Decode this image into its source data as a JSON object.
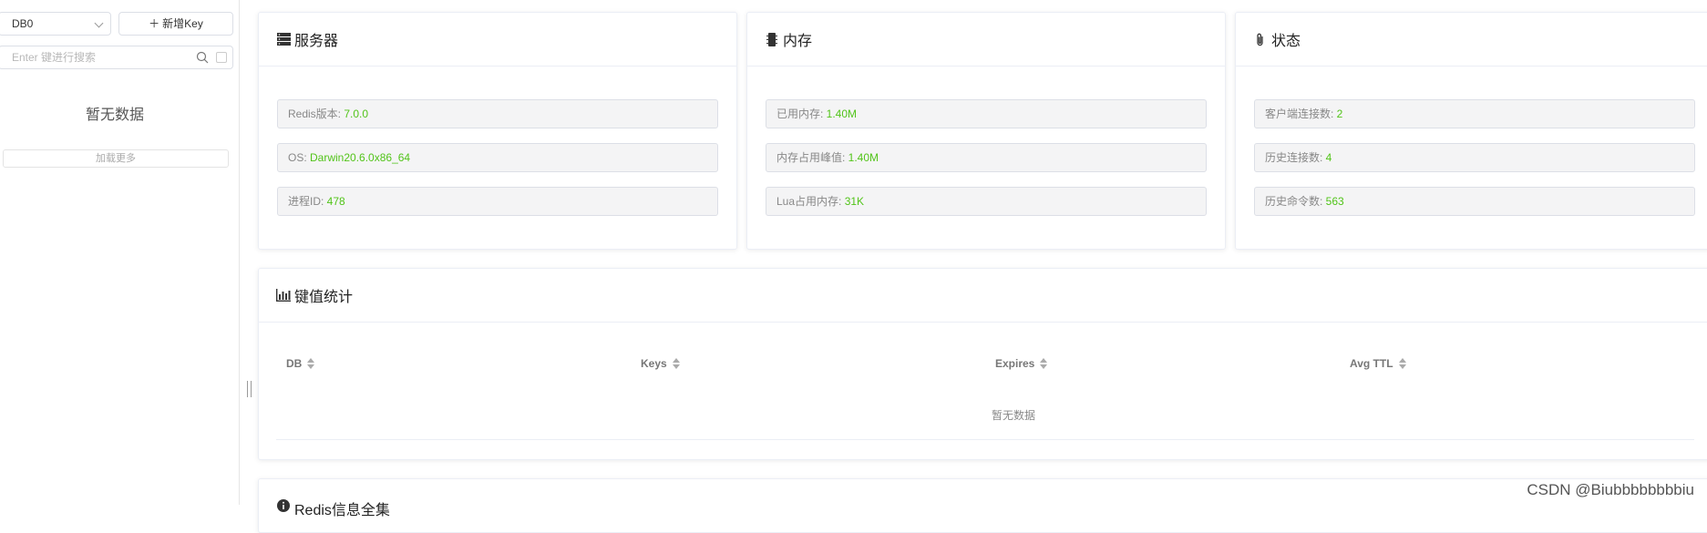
{
  "sidebar": {
    "db_select": "DB0",
    "add_key_label": "新增Key",
    "search_placeholder": "Enter 键进行搜索",
    "empty_text": "暂无数据",
    "load_more": "加载更多"
  },
  "server_card": {
    "title": "服务器",
    "rows": [
      {
        "label": "Redis版本: ",
        "value": "7.0.0"
      },
      {
        "label": "OS: ",
        "value": "Darwin20.6.0x86_64"
      },
      {
        "label": "进程ID: ",
        "value": "478"
      }
    ]
  },
  "memory_card": {
    "title": "内存",
    "rows": [
      {
        "label": "已用内存: ",
        "value": "1.40M"
      },
      {
        "label": "内存占用峰值: ",
        "value": "1.40M"
      },
      {
        "label": "Lua占用内存: ",
        "value": "31K"
      }
    ]
  },
  "status_card": {
    "title": "状态",
    "rows": [
      {
        "label": "客户端连接数: ",
        "value": "2"
      },
      {
        "label": "历史连接数: ",
        "value": "4"
      },
      {
        "label": "历史命令数: ",
        "value": "563"
      }
    ]
  },
  "keystats_card": {
    "title": "键值统计",
    "columns": [
      "DB",
      "Keys",
      "Expires",
      "Avg TTL"
    ],
    "empty_text": "暂无数据"
  },
  "redis_info_card": {
    "title": "Redis信息全集"
  },
  "watermark": "CSDN @Biubbbbbbbbiu",
  "colors": {
    "value_green": "#52c41a",
    "border": "#dcdfe6"
  }
}
